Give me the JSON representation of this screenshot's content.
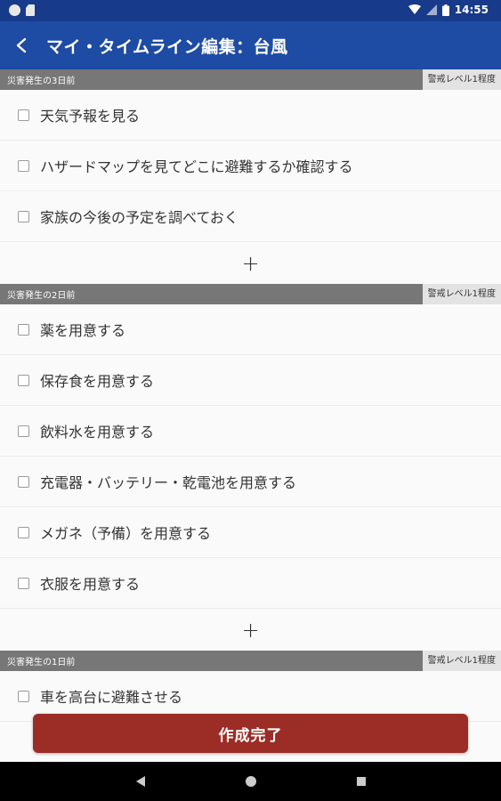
{
  "status_bar": {
    "time": "14:55"
  },
  "app_bar": {
    "title": "マイ・タイムライン編集：台風"
  },
  "sections": [
    {
      "title": "災害発生の3日前",
      "level": "警戒レベル1程度",
      "tasks": [
        "天気予報を見る",
        "ハザードマップを見てどこに避難するか確認する",
        "家族の今後の予定を調べておく"
      ],
      "add": "+"
    },
    {
      "title": "災害発生の2日前",
      "level": "警戒レベル1程度",
      "tasks": [
        "薬を用意する",
        "保存食を用意する",
        "飲料水を用意する",
        "充電器・バッテリー・乾電池を用意する",
        "メガネ（予備）を用意する",
        "衣服を用意する"
      ],
      "add": "+"
    },
    {
      "title": "災害発生の1日前",
      "level": "警戒レベル1程度",
      "tasks": [
        "車を高台に避難させる"
      ]
    }
  ],
  "footer": {
    "complete_label": "作成完了"
  },
  "colors": {
    "app_bar": "#1e4ba3",
    "status_bar": "#173a8a",
    "section_header": "#777777",
    "complete_button": "#9b2d26"
  }
}
